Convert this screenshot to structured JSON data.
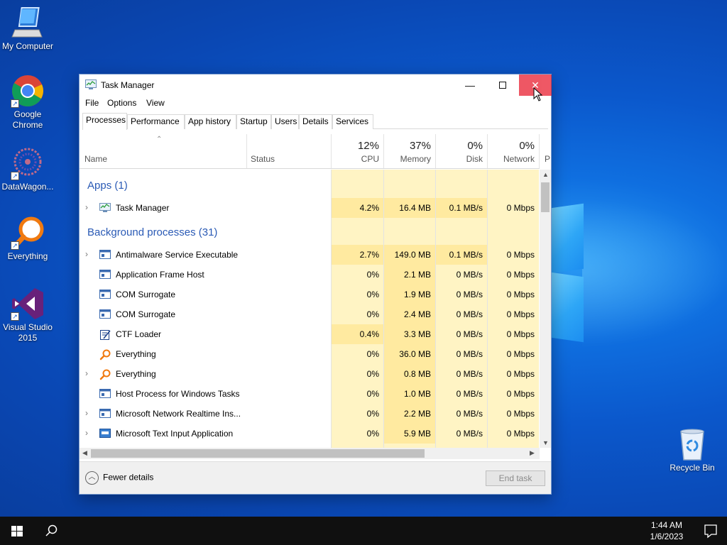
{
  "desktop": {
    "icons": [
      {
        "label": "My Computer",
        "icon": "computer-icon"
      },
      {
        "label": "Google\nChrome",
        "icon": "chrome-icon"
      },
      {
        "label": "DataWagon...",
        "icon": "datawagon-icon"
      },
      {
        "label": "Everything",
        "icon": "everything-icon"
      },
      {
        "label": "Visual Studio\n2015",
        "icon": "visual-studio-icon"
      },
      {
        "label": "Recycle Bin",
        "icon": "recycle-bin-icon"
      }
    ]
  },
  "window": {
    "title": "Task Manager",
    "menu": [
      "File",
      "Options",
      "View"
    ],
    "tabs": [
      "Processes",
      "Performance",
      "App history",
      "Startup",
      "Users",
      "Details",
      "Services"
    ],
    "active_tab": "Processes",
    "columns": {
      "name": "Name",
      "status": "Status",
      "cpu": {
        "pct": "12%",
        "label": "CPU"
      },
      "memory": {
        "pct": "37%",
        "label": "Memory"
      },
      "disk": {
        "pct": "0%",
        "label": "Disk"
      },
      "network": {
        "pct": "0%",
        "label": "Network"
      },
      "power_partial": "P"
    },
    "groups": {
      "apps": "Apps (1)",
      "background": "Background processes (31)"
    },
    "apps": [
      {
        "name": "Task Manager",
        "cpu": "4.2%",
        "memory": "16.4 MB",
        "disk": "0.1 MB/s",
        "network": "0 Mbps",
        "expandable": true
      }
    ],
    "background": [
      {
        "name": "Antimalware Service Executable",
        "cpu": "2.7%",
        "memory": "149.0 MB",
        "disk": "0.1 MB/s",
        "network": "0 Mbps",
        "expandable": true
      },
      {
        "name": "Application Frame Host",
        "cpu": "0%",
        "memory": "2.1 MB",
        "disk": "0 MB/s",
        "network": "0 Mbps",
        "expandable": false
      },
      {
        "name": "COM Surrogate",
        "cpu": "0%",
        "memory": "1.9 MB",
        "disk": "0 MB/s",
        "network": "0 Mbps",
        "expandable": false
      },
      {
        "name": "COM Surrogate",
        "cpu": "0%",
        "memory": "2.4 MB",
        "disk": "0 MB/s",
        "network": "0 Mbps",
        "expandable": false
      },
      {
        "name": "CTF Loader",
        "cpu": "0.4%",
        "memory": "3.3 MB",
        "disk": "0 MB/s",
        "network": "0 Mbps",
        "expandable": false
      },
      {
        "name": "Everything",
        "cpu": "0%",
        "memory": "36.0 MB",
        "disk": "0 MB/s",
        "network": "0 Mbps",
        "expandable": false
      },
      {
        "name": "Everything",
        "cpu": "0%",
        "memory": "0.8 MB",
        "disk": "0 MB/s",
        "network": "0 Mbps",
        "expandable": true
      },
      {
        "name": "Host Process for Windows Tasks",
        "cpu": "0%",
        "memory": "1.0 MB",
        "disk": "0 MB/s",
        "network": "0 Mbps",
        "expandable": false
      },
      {
        "name": "Microsoft Network Realtime Ins...",
        "cpu": "0%",
        "memory": "2.2 MB",
        "disk": "0 MB/s",
        "network": "0 Mbps",
        "expandable": true
      },
      {
        "name": "Microsoft Text Input Application",
        "cpu": "0%",
        "memory": "5.9 MB",
        "disk": "0 MB/s",
        "network": "0 Mbps",
        "expandable": true
      }
    ],
    "footer": {
      "fewer_details": "Fewer details",
      "end_task": "End task"
    }
  },
  "taskbar": {
    "time": "1:44 AM",
    "date": "1/6/2023"
  },
  "colors": {
    "heat_light": "#fff4c4",
    "heat_mid": "#ffeaa0",
    "group_text": "#2a5ab5",
    "close_red": "#e81123"
  }
}
